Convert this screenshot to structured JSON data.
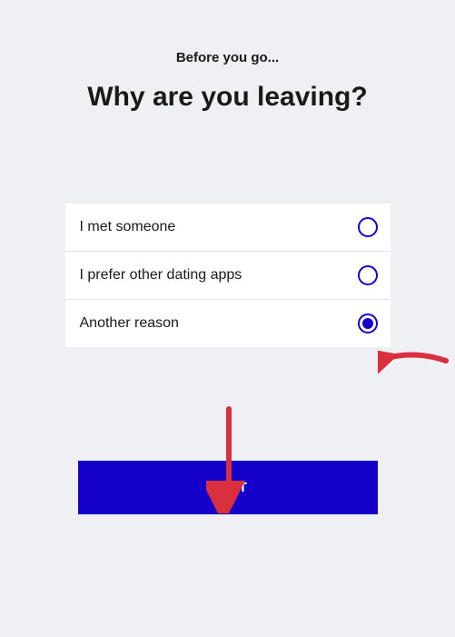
{
  "header": {
    "eyebrow": "Before you go...",
    "headline": "Why are you leaving?"
  },
  "options": [
    {
      "label": "I met someone",
      "selected": false
    },
    {
      "label": "I prefer other dating apps",
      "selected": false
    },
    {
      "label": "Another reason",
      "selected": true
    }
  ],
  "actions": {
    "next_label": "NEXT"
  },
  "colors": {
    "accent": "#1400c8",
    "annotation": "#d8303f"
  }
}
